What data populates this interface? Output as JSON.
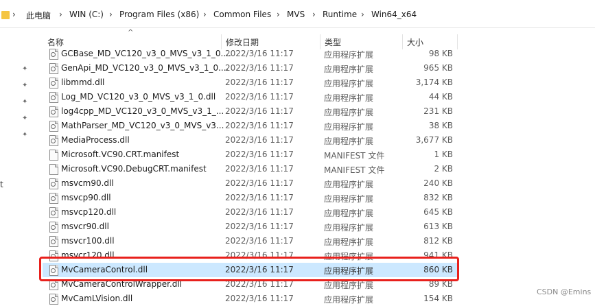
{
  "breadcrumb": [
    "此电脑",
    "WIN (C:)",
    "Program Files (x86)",
    "Common Files",
    "MVS",
    "Runtime",
    "Win64_x64"
  ],
  "columns": {
    "name": "名称",
    "date": "修改日期",
    "type": "类型",
    "size": "大小"
  },
  "nav_fragment": "t",
  "files": [
    {
      "name": "GCBase_MD_VC120_v3_0_MVS_v3_1_0....",
      "date": "2022/3/16 11:17",
      "type": "应用程序扩展",
      "size": "98 KB"
    },
    {
      "name": "GenApi_MD_VC120_v3_0_MVS_v3_1_0....",
      "date": "2022/3/16 11:17",
      "type": "应用程序扩展",
      "size": "965 KB"
    },
    {
      "name": "libmmd.dll",
      "date": "2022/3/16 11:17",
      "type": "应用程序扩展",
      "size": "3,174 KB"
    },
    {
      "name": "Log_MD_VC120_v3_0_MVS_v3_1_0.dll",
      "date": "2022/3/16 11:17",
      "type": "应用程序扩展",
      "size": "44 KB"
    },
    {
      "name": "log4cpp_MD_VC120_v3_0_MVS_v3_1_...",
      "date": "2022/3/16 11:17",
      "type": "应用程序扩展",
      "size": "231 KB"
    },
    {
      "name": "MathParser_MD_VC120_v3_0_MVS_v3...",
      "date": "2022/3/16 11:17",
      "type": "应用程序扩展",
      "size": "38 KB"
    },
    {
      "name": "MediaProcess.dll",
      "date": "2022/3/16 11:17",
      "type": "应用程序扩展",
      "size": "3,677 KB"
    },
    {
      "name": "Microsoft.VC90.CRT.manifest",
      "date": "2022/3/16 11:17",
      "type": "MANIFEST 文件",
      "size": "1 KB"
    },
    {
      "name": "Microsoft.VC90.DebugCRT.manifest",
      "date": "2022/3/16 11:17",
      "type": "MANIFEST 文件",
      "size": "2 KB"
    },
    {
      "name": "msvcm90.dll",
      "date": "2022/3/16 11:17",
      "type": "应用程序扩展",
      "size": "240 KB"
    },
    {
      "name": "msvcp90.dll",
      "date": "2022/3/16 11:17",
      "type": "应用程序扩展",
      "size": "832 KB"
    },
    {
      "name": "msvcp120.dll",
      "date": "2022/3/16 11:17",
      "type": "应用程序扩展",
      "size": "645 KB"
    },
    {
      "name": "msvcr90.dll",
      "date": "2022/3/16 11:17",
      "type": "应用程序扩展",
      "size": "613 KB"
    },
    {
      "name": "msvcr100.dll",
      "date": "2022/3/16 11:17",
      "type": "应用程序扩展",
      "size": "812 KB"
    },
    {
      "name": "msvcr120.dll",
      "date": "2022/3/16 11:17",
      "type": "应用程序扩展",
      "size": "941 KB"
    },
    {
      "name": "MvCameraControl.dll",
      "date": "2022/3/16 11:17",
      "type": "应用程序扩展",
      "size": "860 KB",
      "selected": true
    },
    {
      "name": "MvCameraControlWrapper.dll",
      "date": "2022/3/16 11:17",
      "type": "应用程序扩展",
      "size": "89 KB"
    },
    {
      "name": "MvCamLVision.dll",
      "date": "2022/3/16 11:17",
      "type": "应用程序扩展",
      "size": "154 KB"
    }
  ],
  "watermark": "CSDN @Emins",
  "colors": {
    "selection": "#cce8ff",
    "annotation": "#e8201c",
    "folder": "#f5c542"
  }
}
